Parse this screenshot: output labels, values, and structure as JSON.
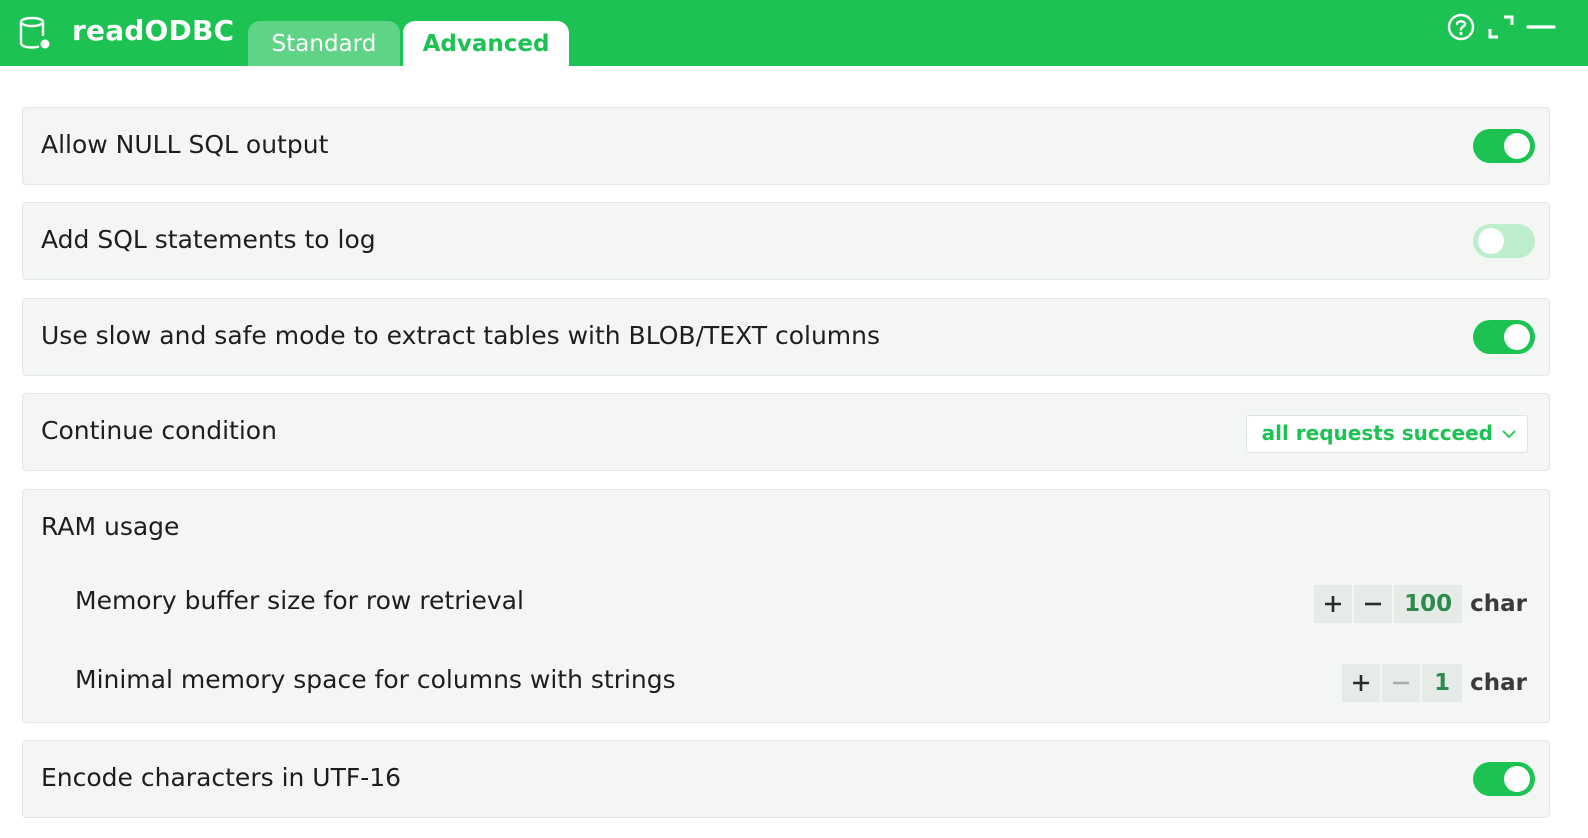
{
  "app": {
    "title": "readODBC",
    "icon": "database-icon"
  },
  "tabs": [
    {
      "label": "Standard",
      "active": false
    },
    {
      "label": "Advanced",
      "active": true
    }
  ],
  "header_buttons": [
    "help-icon",
    "expand-icon",
    "minimize-icon"
  ],
  "colors": {
    "accent": "#1cc353",
    "tab_inactive": "#5fd386",
    "toggle_off": "#bdeecb",
    "row_bg": "#f4f6f4",
    "stepper_value": "#2e8b4e"
  },
  "settings": {
    "allow_null": {
      "label": "Allow NULL SQL output",
      "enabled": true
    },
    "add_sql_log": {
      "label": "Add SQL statements to log",
      "enabled": false
    },
    "slow_safe_mode": {
      "label": "Use slow and safe mode to extract tables with BLOB/TEXT columns",
      "enabled": true
    },
    "continue_condition": {
      "label": "Continue condition",
      "value": "all requests succeed"
    },
    "ram_usage": {
      "label": "RAM usage",
      "buffer_size": {
        "label": "Memory buffer size for row retrieval",
        "value": "100",
        "unit": "char"
      },
      "min_memory": {
        "label": "Minimal memory space for columns with strings",
        "value": "1",
        "unit": "char",
        "decrement_disabled": true
      }
    },
    "utf16": {
      "label": "Encode characters in UTF-16",
      "enabled": true
    }
  }
}
